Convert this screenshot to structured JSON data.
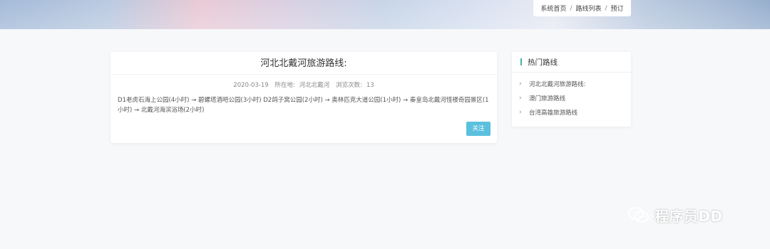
{
  "breadcrumb": {
    "items": [
      "系统首页",
      "路线列表",
      "预订"
    ],
    "separator": "/"
  },
  "article": {
    "title": "河北北戴河旅游路线:",
    "date": "2020-03-19",
    "location_label": "所在地:",
    "location": "河北北戴河",
    "views_label": "浏览次数:",
    "views": "13",
    "description": "D1老虎石海上公园(4小时) → 碧螺塔酒吧公园(3小时) D2鸽子窝公园(2小时) → 奥林匹克大道公园(1小时) → 秦皇岛北戴河怪楼奇园景区(1小时) → 北戴河海滨浴场(2小时)",
    "follow_button": "关注"
  },
  "sidebar": {
    "title": "热门路线",
    "items": [
      "河北北戴河旅游路线:",
      "澳门旅游路线",
      "台湾高雄旅游路线"
    ]
  },
  "watermark": {
    "text": "程序员DD",
    "icon": "wechat-icon"
  },
  "colors": {
    "accent": "#5bc0de",
    "sidebar_bar": "#3db5a6",
    "background": "#f7f8fa"
  }
}
